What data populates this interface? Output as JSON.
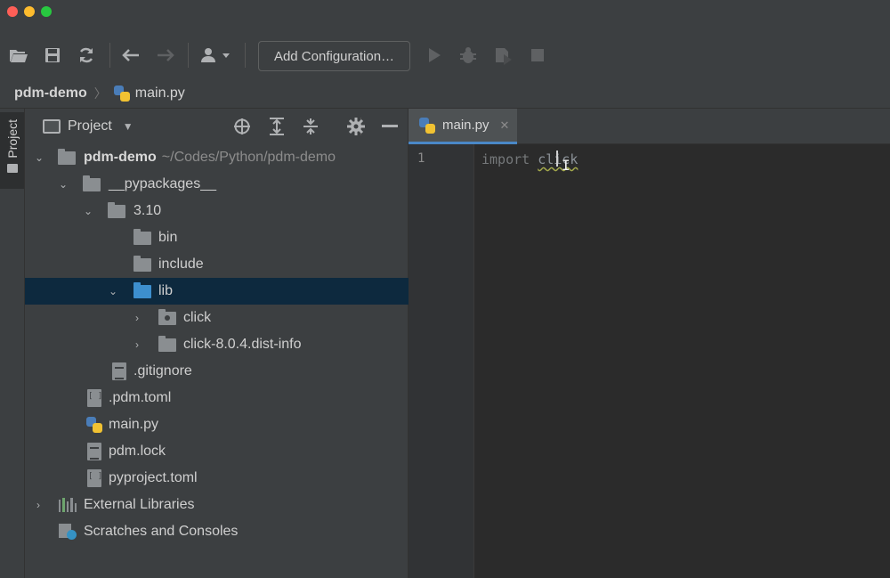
{
  "toolbar": {
    "add_configuration": "Add Configuration…"
  },
  "breadcrumb": {
    "root": "pdm-demo",
    "separator": "〉",
    "file": "main.py"
  },
  "side_strip": {
    "project_tab": "Project"
  },
  "project_panel": {
    "title": "Project"
  },
  "tree": {
    "root_name": "pdm-demo",
    "root_path": "~/Codes/Python/pdm-demo",
    "pypackages": "__pypackages__",
    "version": "3.10",
    "bin": "bin",
    "include": "include",
    "lib": "lib",
    "click": "click",
    "dist_info": "click-8.0.4.dist-info",
    "gitignore": ".gitignore",
    "pdm_toml": ".pdm.toml",
    "main_py": "main.py",
    "pdm_lock": "pdm.lock",
    "pyproject": "pyproject.toml",
    "external_libraries": "External Libraries",
    "scratches": "Scratches and Consoles"
  },
  "editor": {
    "tab_label": "main.py",
    "tab_close": "✕",
    "line_number": "1",
    "code_keyword": "import",
    "code_module": "click"
  },
  "colors": {
    "selection": "#0d293e",
    "tab_underline": "#4a88c7",
    "lib_folder": "#3d8fce"
  }
}
